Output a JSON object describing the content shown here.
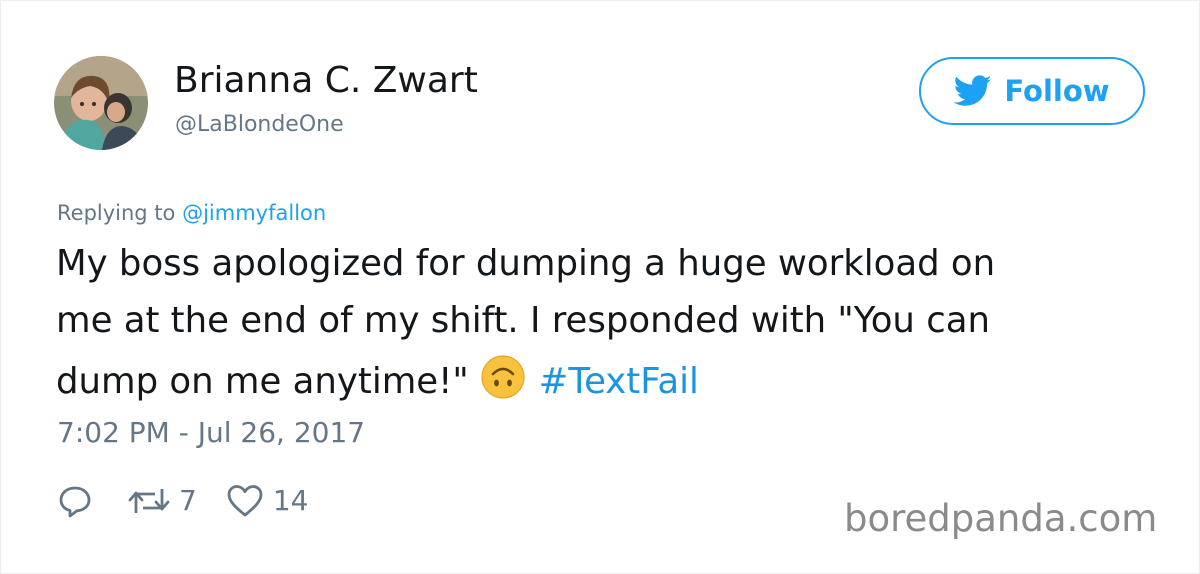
{
  "user": {
    "display_name": "Brianna C. Zwart",
    "handle": "@LaBlondeOne",
    "avatar_icon": "user-avatar-photo"
  },
  "follow_button": {
    "label": "Follow",
    "icon": "twitter-bird-icon",
    "accent_color": "#1da1f2"
  },
  "reply_context": {
    "prefix": "Replying to",
    "mention": "@jimmyfallon"
  },
  "tweet": {
    "line1": "My boss apologized for dumping a huge workload on",
    "line2": "me at the end of my shift. I responded with \"You can",
    "line3": "dump on me anytime!\"",
    "emoji": "upside-down-face-emoji",
    "hashtag": "#TextFail",
    "timestamp": "7:02 PM - Jul 26, 2017"
  },
  "actions": {
    "reply_icon": "reply-icon",
    "retweet_icon": "retweet-icon",
    "retweet_count": "7",
    "like_icon": "heart-icon",
    "like_count": "14"
  },
  "watermark": "boredpanda.com",
  "colors": {
    "text": "#14171a",
    "secondary": "#657786",
    "link": "#1da1f2",
    "hashtag": "#1b95e0"
  }
}
